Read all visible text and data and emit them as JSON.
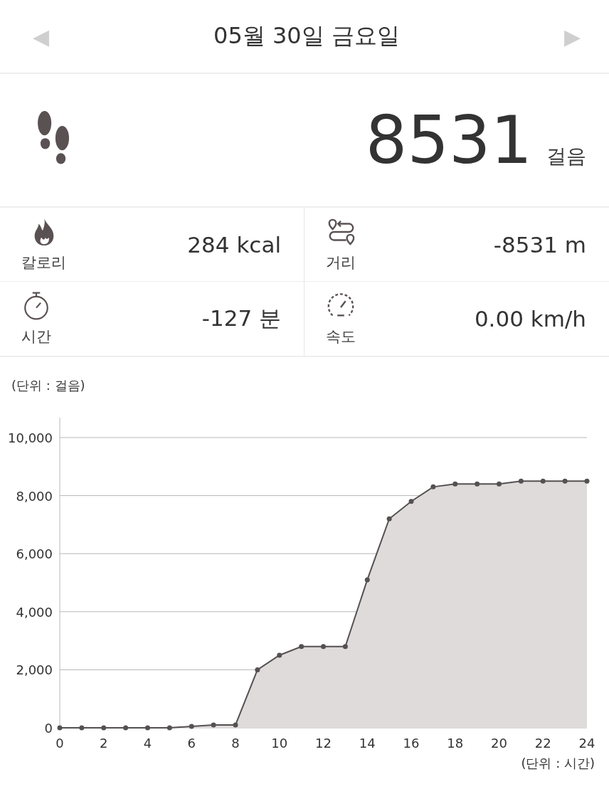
{
  "header": {
    "prev": "◀",
    "title": "05월 30일 금요일",
    "next": "▶"
  },
  "steps": {
    "value": "8531",
    "unit": "걸음"
  },
  "stats": [
    {
      "kind": "flame",
      "label": "칼로리",
      "value": "284 kcal"
    },
    {
      "kind": "route",
      "label": "거리",
      "value": "-8531 m"
    },
    {
      "kind": "stopwatch",
      "label": "시간",
      "value": "-127 분"
    },
    {
      "kind": "gauge",
      "label": "속도",
      "value": "0.00 km/h"
    }
  ],
  "chart": {
    "unit_label": "(단위 : 걸음)",
    "x_unit_label": "(단위 : 시간)",
    "chart_data": {
      "type": "area",
      "x": [
        0,
        1,
        2,
        3,
        4,
        5,
        6,
        7,
        8,
        9,
        10,
        11,
        12,
        13,
        14,
        15,
        16,
        17,
        18,
        19,
        20,
        21,
        22,
        23,
        24
      ],
      "series": [
        {
          "color": "#555052",
          "values": [
            0,
            0,
            0,
            0,
            0,
            0,
            50,
            100,
            100,
            2000,
            2500,
            2800,
            2800,
            2800,
            5100,
            7200,
            7800,
            8300,
            8400,
            8400,
            8400,
            8500,
            8500,
            8500,
            8500
          ]
        }
      ],
      "grid": true,
      "xlim": [
        0,
        24
      ],
      "ylim": [
        0,
        10000
      ],
      "xticks": [
        0,
        2,
        4,
        6,
        8,
        10,
        12,
        14,
        16,
        18,
        20,
        22,
        24
      ],
      "yticks": [
        {
          "value": 0,
          "label": "0"
        },
        {
          "value": 2000,
          "label": "2,000"
        },
        {
          "value": 4000,
          "label": "4,000"
        },
        {
          "value": 6000,
          "label": "6,000"
        },
        {
          "value": 8000,
          "label": "8,000"
        },
        {
          "value": 10000,
          "label": "10,000"
        }
      ]
    }
  }
}
